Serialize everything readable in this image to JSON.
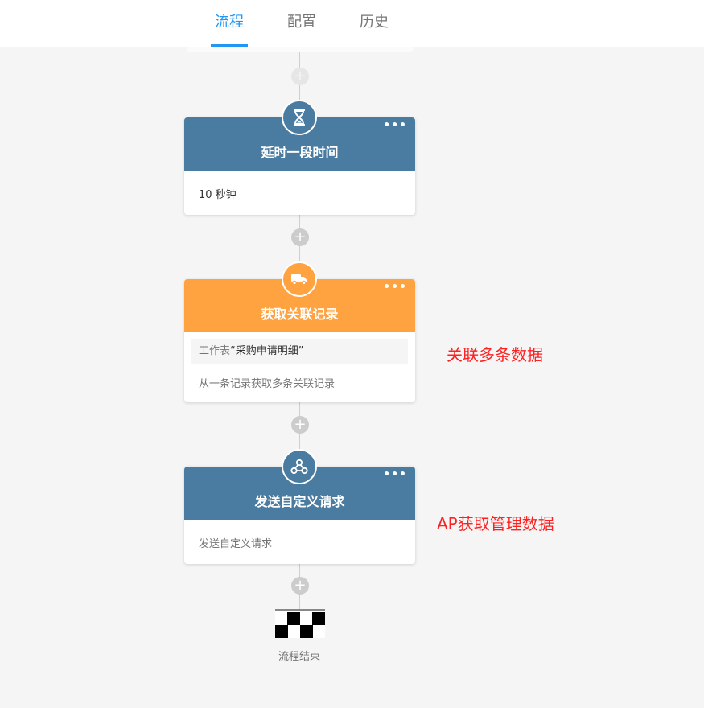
{
  "tabs": [
    {
      "label": "流程",
      "active": true
    },
    {
      "label": "配置",
      "active": false
    },
    {
      "label": "历史",
      "active": false
    }
  ],
  "nodes": {
    "delay": {
      "title": "延时一段时间",
      "icon": "hourglass-icon",
      "color": "#4a7ba0",
      "body": "10 秒钟"
    },
    "related": {
      "title": "获取关联记录",
      "icon": "truck-icon",
      "color": "#ffa340",
      "detail_prefix": "工作表",
      "detail_value": "“采购申请明细”",
      "body": "从一条记录获取多条关联记录"
    },
    "webhook": {
      "title": "发送自定义请求",
      "icon": "webhook-icon",
      "color": "#4a7ba0",
      "body": "发送自定义请求"
    }
  },
  "menu_glyph": "•••",
  "plus_glyph": "+",
  "annotations": {
    "related": "关联多条数据",
    "webhook": "AP获取管理数据"
  },
  "finish": {
    "label": "流程结束",
    "icon": "checkered-flag-icon"
  },
  "colors": {
    "accent": "#2196f3",
    "annotation": "#ff2020"
  }
}
